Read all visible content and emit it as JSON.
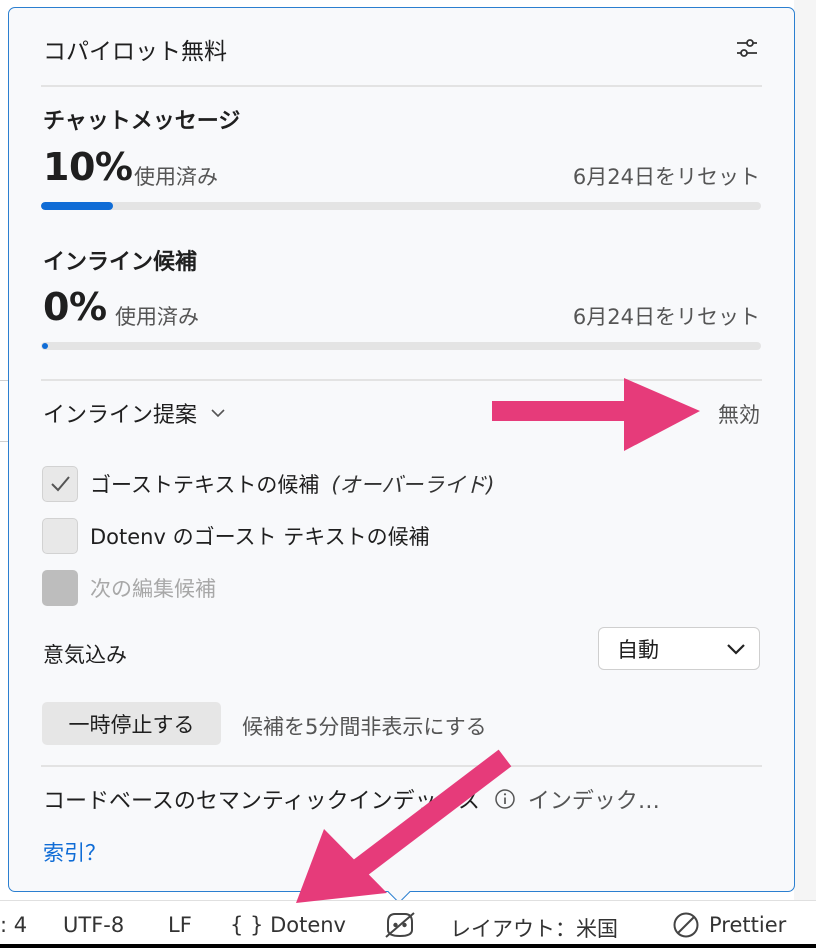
{
  "popup": {
    "title": "コパイロット無料",
    "settings_icon": "sliders-icon"
  },
  "chat": {
    "section_title": "チャットメッセージ",
    "percent": "10%",
    "used_label": "使用済み",
    "reset_label": "6月24日をリセット",
    "progress": 0.1
  },
  "inline_completion": {
    "section_title": "インライン候補",
    "percent": "0%",
    "used_label": "使用済み",
    "reset_label": "6月24日をリセット",
    "progress": 0.0
  },
  "inline_suggestions": {
    "label": "インライン提案",
    "state": "無効"
  },
  "checkboxes": [
    {
      "label": "ゴーストテキストの候補",
      "note": "(オーバーライド)",
      "checked": true
    },
    {
      "label": "Dotenv のゴースト テキストの候補",
      "checked": false
    },
    {
      "label": "次の編集候補",
      "disabled": true
    }
  ],
  "motivation": {
    "label": "意気込み",
    "value": "自動"
  },
  "pause": {
    "button_label": "一時停止する",
    "description": "候補を5分間非表示にする"
  },
  "semantic_index": {
    "label": "コードベースのセマンティックインデックス",
    "status": "インデック…",
    "link": "索引？"
  },
  "statusbar": {
    "indent": ": 4",
    "encoding": "UTF-8",
    "eol": "LF",
    "language": "{ } Dotenv",
    "layout": "レイアウト：米国",
    "prettier": "Prettier"
  },
  "colors": {
    "accent": "#0f6cd6",
    "border": "#2b7fd0",
    "annotation_arrow": "#e63b7a"
  }
}
